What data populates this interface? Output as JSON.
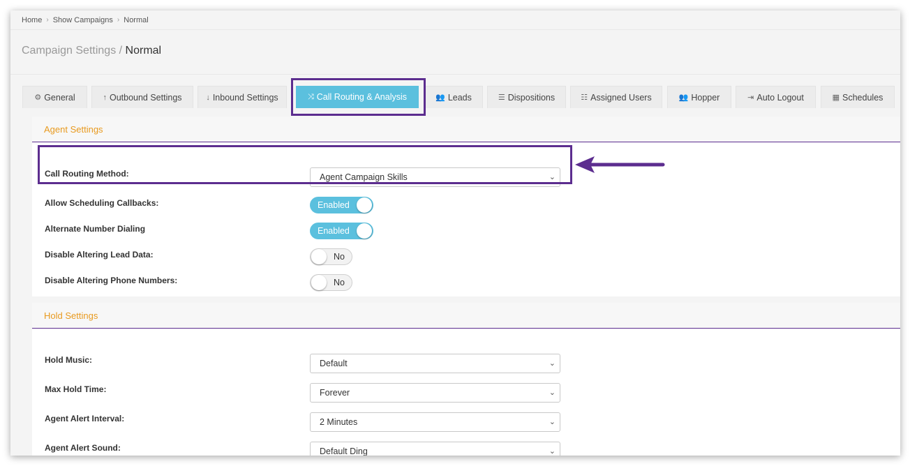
{
  "breadcrumb": {
    "items": [
      "Home",
      "Show Campaigns",
      "Normal"
    ],
    "separator": "›"
  },
  "page_title": {
    "prefix": "Campaign Settings /",
    "current": "Normal"
  },
  "tabs": [
    {
      "label": "General",
      "icon": "gears-icon"
    },
    {
      "label": "Outbound Settings",
      "icon": "arrow-up-icon"
    },
    {
      "label": "Inbound Settings",
      "icon": "arrow-down-icon"
    },
    {
      "label": "Call Routing & Analysis",
      "icon": "shuffle-icon",
      "active": true
    },
    {
      "label": "Leads",
      "icon": "users-icon"
    },
    {
      "label": "Dispositions",
      "icon": "list-icon"
    },
    {
      "label": "Assigned Users",
      "icon": "list-ordered-icon"
    },
    {
      "label": "Hopper",
      "icon": "users-icon"
    },
    {
      "label": "Auto Logout",
      "icon": "sign-out-icon"
    },
    {
      "label": "Schedules",
      "icon": "calendar-icon"
    }
  ],
  "agent_settings": {
    "title": "Agent Settings",
    "call_routing_method": {
      "label": "Call Routing Method:",
      "value": "Agent Campaign Skills"
    },
    "allow_scheduling_callbacks": {
      "label": "Allow Scheduling Callbacks:",
      "state": "Enabled"
    },
    "alternate_number_dialing": {
      "label": "Alternate Number Dialing",
      "state": "Enabled"
    },
    "disable_altering_lead_data": {
      "label": "Disable Altering Lead Data:",
      "state": "No"
    },
    "disable_altering_phone_numbers": {
      "label": "Disable Altering Phone Numbers:",
      "state": "No"
    }
  },
  "hold_settings": {
    "title": "Hold Settings",
    "hold_music": {
      "label": "Hold Music:",
      "value": "Default"
    },
    "max_hold_time": {
      "label": "Max Hold Time:",
      "value": "Forever"
    },
    "agent_alert_interval": {
      "label": "Agent Alert Interval:",
      "value": "2 Minutes"
    },
    "agent_alert_sound": {
      "label": "Agent Alert Sound:",
      "value": "Default Ding"
    }
  },
  "colors": {
    "accent": "#5bc0de",
    "highlight": "#5c2d8f",
    "section_title": "#e89a1f"
  }
}
